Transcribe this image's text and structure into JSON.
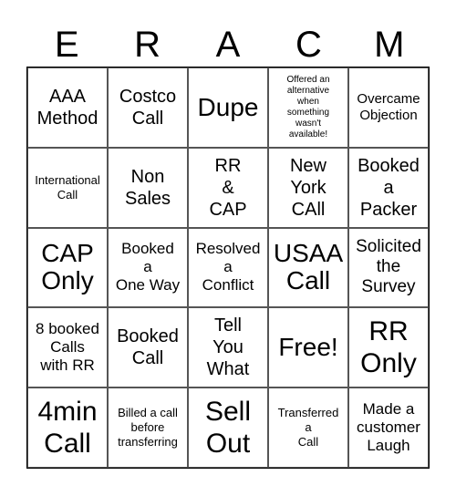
{
  "header": {
    "letters": [
      "E",
      "R",
      "A",
      "C",
      "M"
    ]
  },
  "cells": [
    "AAA\nMethod",
    "Costco\nCall",
    "Dupe",
    "Offered an\nalternative\nwhen\nsomething\nwasn't\navailable!",
    "Overcame\nObjection",
    "International\nCall",
    "Non\nSales",
    "RR\n&\nCAP",
    "New\nYork\nCAll",
    "Booked\na\nPacker",
    "CAP\nOnly",
    "Booked\na\nOne Way",
    "Resolved\na\nConflict",
    "USAA\nCall",
    "Solicited\nthe\nSurvey",
    "8 booked\nCalls\nwith RR",
    "Booked\nCall",
    "Tell\nYou\nWhat",
    "Free!",
    "RR\nOnly",
    "4min\nCall",
    "Billed a call\nbefore\ntransferring",
    "Sell\nOut",
    "Transferred\na\nCall",
    "Made a\ncustomer\nLaugh"
  ]
}
